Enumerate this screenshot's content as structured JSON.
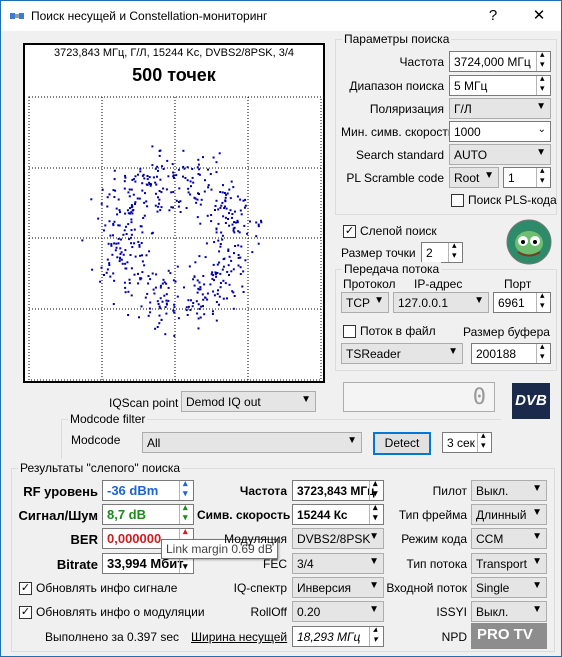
{
  "window": {
    "title": "Поиск несущей и Constellation-мониторинг",
    "help_label": "?",
    "close_label": "✕"
  },
  "constellation": {
    "header": "3723,843 МГц, Г/Л, 15244 Kc, DVBS2/8PSK, 3/4",
    "points_label": "500 точек",
    "dot_color": "#0000aa"
  },
  "search_params": {
    "legend": "Параметры поиска",
    "frequency_label": "Частота",
    "frequency_value": "3724,000 МГц",
    "range_label": "Диапазон поиска",
    "range_value": "5 МГц",
    "polarization_label": "Поляризация",
    "polarization_value": "Г/Л",
    "min_sr_label": "Мин. симв. скорость",
    "min_sr_value": "1000",
    "search_standard_label": "Search standard",
    "search_standard_value": "AUTO",
    "pl_scramble_label": "PL Scramble code",
    "pl_scramble_mode": "Root",
    "pl_scramble_value": "1",
    "pls_search_label": "Поиск PLS-кода"
  },
  "blind": {
    "blind_search_label": "Слепой поиск",
    "point_size_label": "Размер точки",
    "point_size_value": "2"
  },
  "stream": {
    "legend": "Передача потока",
    "protocol_label": "Протокол",
    "ip_label": "IP-адрес",
    "port_label": "Порт",
    "protocol_value": "TCP",
    "ip_value": "127.0.0.1",
    "port_value": "6961",
    "to_file_label": "Поток в файл",
    "buffer_label": "Размер буфера",
    "reader_value": "TSReader",
    "buffer_value": "200188"
  },
  "iq": {
    "iqscan_label": "IQScan point",
    "iqscan_value": "Demod IQ out",
    "display_value": "0",
    "dvb_logo": "DVB"
  },
  "modcode": {
    "legend": "Modcode filter",
    "label": "Modcode",
    "value": "All",
    "detect_label": "Detect",
    "timeout_value": "3 сек"
  },
  "results": {
    "legend": "Результаты \"слепого\" поиска",
    "rf_label": "RF уровень",
    "rf_value": "-36 dBm",
    "snr_label": "Сигнал/Шум",
    "snr_value": "8,7 dB",
    "ber_label": "BER",
    "ber_value": "0,000000",
    "bitrate_label": "Bitrate",
    "bitrate_value": "33,994 Мбит",
    "freq_label": "Частота",
    "freq_value": "3723,843 МГц",
    "sr_label": "Симв. скорость",
    "sr_value": "15244 Кс",
    "mod_label": "Модуляция",
    "mod_value": "DVBS2/8PSK",
    "fec_label": "FEC",
    "fec_value": "3/4",
    "iq_spectrum_label": "IQ-спектр",
    "iq_spectrum_value": "Инверсия",
    "rolloff_label": "RollOff",
    "rolloff_value": "0.20",
    "bandwidth_label": "Ширина несущей",
    "bandwidth_value": "18,293 МГц",
    "pilot_label": "Пилот",
    "pilot_value": "Выкл.",
    "frame_label": "Тип фрейма",
    "frame_value": "Длинный",
    "coding_label": "Режим кода",
    "coding_value": "CCM",
    "stream_type_label": "Тип потока",
    "stream_type_value": "Transport",
    "input_stream_label": "Входной поток",
    "input_stream_value": "Single",
    "issyi_label": "ISSYI",
    "issyi_value": "Выкл.",
    "npd_label": "NPD",
    "update_signal_label": "Обновлять инфо сигнале",
    "update_mod_label": "Обновлять инфо о модуляции",
    "done_label": "Выполнено за 0.397 sec",
    "tooltip": "Link margin 0.69 dB"
  },
  "watermark": "PRO TV"
}
